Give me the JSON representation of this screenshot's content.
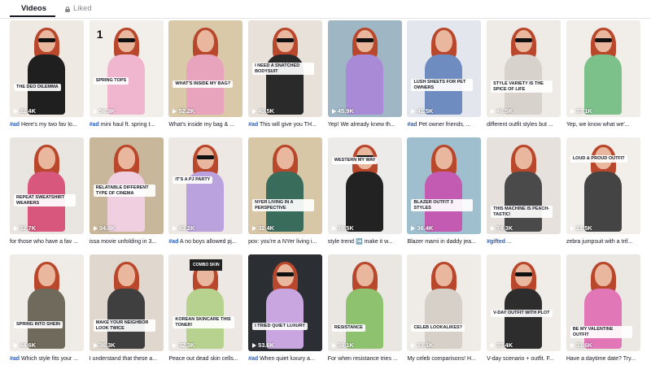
{
  "tabs": {
    "videos": "Videos",
    "liked": "Liked"
  },
  "videos": [
    {
      "views": "32.4K",
      "tag": "#ad",
      "title": " Here's my two fav lo...",
      "overlay": "THE DEO DILEMMA",
      "bg": "#efe9e3",
      "outfit": "#1f1f1f",
      "glasses": true
    },
    {
      "views": "56.9K",
      "tag": "#ad",
      "title": " mini haul ft. spring t...",
      "overlay": "SPRING TOPS",
      "bg": "#f2eeea",
      "outfit": "#f0b6cf",
      "glasses": true,
      "number": "1"
    },
    {
      "views": "52.2K",
      "tag": "",
      "title": "What's inside my bag & ...",
      "overlay": "WHAT'S INSIDE MY BAG?",
      "bg": "#d9c9a9",
      "outfit": "#e8a3bd"
    },
    {
      "views": "40.5K",
      "tag": "#ad",
      "title": " This will give you TH...",
      "overlay": "I NEED A SNATCHED BODYSUIT",
      "bg": "#e8e1d9",
      "outfit": "#2a2a2a",
      "glasses": true
    },
    {
      "views": "45.9K",
      "tag": "",
      "title": "Yep! We already knew th...",
      "overlay": "",
      "bg": "#9fb7c4",
      "outfit": "#a98ad6",
      "glasses": true
    },
    {
      "views": "41.5K",
      "tag": "#ad",
      "title": " Pet owner friends, ...",
      "overlay": "LUSH SHEETS FOR PET OWNERS",
      "bg": "#e4e6ee",
      "outfit": "#6e8cc0"
    },
    {
      "views": "46.5K",
      "tag": "",
      "title": "different outfit styles but ...",
      "overlay": "STYLE VARIETY IS THE SPICE OF LIFE",
      "bg": "#eeeae6",
      "outfit": "#d7d2cc",
      "glasses": true
    },
    {
      "views": "37.1K",
      "tag": "",
      "title": "Yep, we know what we'...",
      "overlay": "",
      "bg": "#f1ede8",
      "outfit": "#7cc08a",
      "glasses": true
    },
    {
      "views": "32.7K",
      "tag": "",
      "title": "for those who have a fav ...",
      "overlay": "REPEAT SWEATSHIRT WEARERS",
      "bg": "#e9e5e1",
      "outfit": "#d8577c"
    },
    {
      "views": "34.4K",
      "tag": "",
      "title": "issa movie unfolding in 3...",
      "overlay": "RELATABLE DIFFERENT TYPE OF CINEMA",
      "bg": "#c9b79c",
      "outfit": "#f0cfe0"
    },
    {
      "views": "43.2K",
      "tag": "#ad",
      "title": " A no boys allowed pj...",
      "overlay": "IT'S A PJ PARTY",
      "bg": "#ede8e4",
      "outfit": "#b9a2dd",
      "glasses": true
    },
    {
      "views": "32.4K",
      "tag": "",
      "title": "pov: you're a NYer living i...",
      "overlay": "NYer LIVING IN A PERSPECTIVE",
      "bg": "#d8c7a6",
      "outfit": "#3a6c5c"
    },
    {
      "views": "38.5K",
      "tag": "",
      "title": "style trend ➡️ make it w...",
      "overlay": "WESTERN MY WAY",
      "bg": "#ecebea",
      "outfit": "#222222",
      "glasses": true
    },
    {
      "views": "36.4K",
      "tag": "",
      "title": "Blazer mami in daddy jea...",
      "overlay": "BLAZER OUTFIT 3 STYLES",
      "bg": "#9fbfcf",
      "outfit": "#c45bb2"
    },
    {
      "views": "74.3K",
      "tag": "#gifted",
      "title": " ...",
      "overlay": "THIS MACHINE IS PEACH-TASTIC!",
      "bg": "#e6e1dc",
      "outfit": "#4a4a4a"
    },
    {
      "views": "21.5K",
      "tag": "",
      "title": "zebra jumpsuit with a trif...",
      "overlay": "LOUD & PROUD OUTFIT",
      "bg": "#f2efeb",
      "outfit": "#444444"
    },
    {
      "views": "44.6K",
      "tag": "#ad",
      "title": " Which style fits your ...",
      "overlay": "SPRING INTO SHEIN",
      "bg": "#efebe7",
      "outfit": "#6f6a5b"
    },
    {
      "views": "36.3K",
      "tag": "",
      "title": "I understand that these a...",
      "overlay": "MAKE YOUR NEIGHBOR LOOK TWICE",
      "bg": "#e0d8cf",
      "outfit": "#3f3f3f"
    },
    {
      "views": "32.3K",
      "tag": "",
      "title": "Peace out dead skin cells...",
      "overlay": "KOREAN SKINCARE THIS TONER!",
      "bg": "#ede8e3",
      "outfit": "#b7d18f",
      "board": "COMBO SKIN"
    },
    {
      "views": "53.6K",
      "tag": "#ad",
      "title": " When quiet luxury a...",
      "overlay": "I TRIED QUIET LUXURY",
      "bg": "#2b2e33",
      "outfit": "#c9a6e0",
      "glasses": true
    },
    {
      "views": "34.1K",
      "tag": "",
      "title": "For when resistance tries ...",
      "overlay": "RESISTANCE",
      "bg": "#eae6e2",
      "outfit": "#8ec26f"
    },
    {
      "views": "33.1K",
      "tag": "",
      "title": "My celeb comparisons! H...",
      "overlay": "CELEB LOOKALIKES?",
      "bg": "#efebe7",
      "outfit": "#d6d0c8"
    },
    {
      "views": "37.4K",
      "tag": "",
      "title": "V-day scenario + outfit. F...",
      "overlay": "V-DAY OUTFIT WITH PLOT",
      "bg": "#f0ece8",
      "outfit": "#2d2d2d",
      "glasses": true
    },
    {
      "views": "31.6K",
      "tag": "",
      "title": "Have a daytime date? Try...",
      "overlay": "BE MY VALENTINE OUTFIT",
      "bg": "#ebe7e3",
      "outfit": "#e277b8"
    }
  ]
}
